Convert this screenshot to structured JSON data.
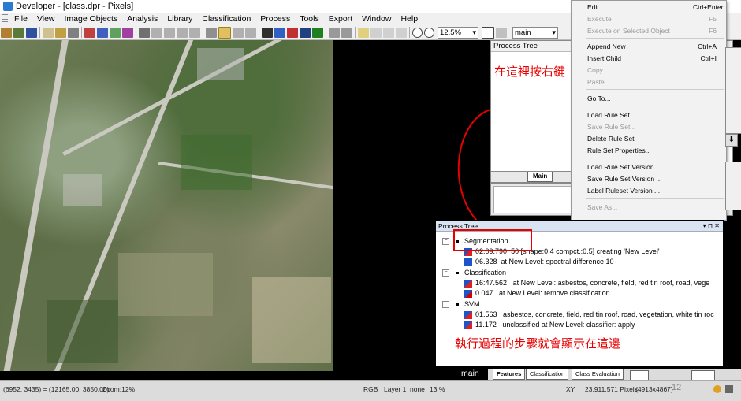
{
  "window": {
    "title": "Developer - [class.dpr - Pixels]"
  },
  "menu": [
    "File",
    "View",
    "Image Objects",
    "Analysis",
    "Library",
    "Classification",
    "Process",
    "Tools",
    "Export",
    "Window",
    "Help"
  ],
  "toolbar": {
    "zoom": "12.5%",
    "level": "main"
  },
  "process_tree_top": {
    "title": "Process Tree",
    "note": "在這裡按右鍵",
    "tab": "Main"
  },
  "context_menu": {
    "items": [
      {
        "label": "Edit...",
        "shortcut": "Ctrl+Enter",
        "enabled": true
      },
      {
        "label": "Execute",
        "shortcut": "F5",
        "enabled": false
      },
      {
        "label": "Execute on Selected Object",
        "shortcut": "F6",
        "enabled": false
      },
      {
        "label": "Append New",
        "shortcut": "Ctrl+A",
        "enabled": true
      },
      {
        "label": "Insert Child",
        "shortcut": "Ctrl+I",
        "enabled": true
      },
      {
        "label": "Copy",
        "shortcut": "",
        "enabled": false
      },
      {
        "label": "Paste",
        "shortcut": "",
        "enabled": false
      },
      {
        "label": "Go To...",
        "shortcut": "",
        "enabled": true
      },
      {
        "label": "Load Rule Set...",
        "shortcut": "",
        "enabled": true
      },
      {
        "label": "Save Rule Set...",
        "shortcut": "",
        "enabled": false
      },
      {
        "label": "Delete Rule Set",
        "shortcut": "",
        "enabled": true
      },
      {
        "label": "Rule Set Properties...",
        "shortcut": "",
        "enabled": true
      },
      {
        "label": "Load Rule Set Version ...",
        "shortcut": "",
        "enabled": true
      },
      {
        "label": "Save Rule Set Version ...",
        "shortcut": "",
        "enabled": true
      },
      {
        "label": "Label Ruleset Version ...",
        "shortcut": "",
        "enabled": true
      },
      {
        "label": "Save As...",
        "shortcut": "",
        "enabled": false
      }
    ]
  },
  "process_tree": {
    "title": "Process Tree",
    "groups": [
      {
        "name": "Segmentation",
        "rows": [
          {
            "time": "02:09.790",
            "text": "50 [shape:0.4 compct.:0.5] creating 'New Level'"
          },
          {
            "time": "06.328",
            "text": "at New Level: spectral difference 10"
          }
        ]
      },
      {
        "name": "Classification",
        "rows": [
          {
            "time": "16:47.562",
            "text": "at New Level: asbestos, concrete, field, red tin roof, road, vege"
          },
          {
            "time": "0.047",
            "text": "at New Level: remove classification"
          }
        ]
      },
      {
        "name": "SVM",
        "rows": [
          {
            "time": "01.563",
            "text": "asbestos, concrete, field, red tin roof, road, vegetation, white tin roc"
          },
          {
            "time": "11.172",
            "text": "unclassified at New Level: classifier: apply"
          }
        ]
      }
    ],
    "note": "執行過程的步驟就會顯示在這邊"
  },
  "bottom": {
    "main_label": "main",
    "tabs": [
      "Features",
      "Classification",
      "Class Evaluation"
    ],
    "page_number": "12"
  },
  "status": {
    "coords": "(6952, 3435) = (12165.00, 3850.00)",
    "zoom": "Zoom:12%",
    "mode": "RGB",
    "layer": "Layer 1",
    "none": "none",
    "percent": "13 %",
    "xy": "XY",
    "pixels": "23,911,571 Pixels",
    "size": "(4913x4867)"
  },
  "colors": {
    "annotation_red": "#e60000",
    "header_blue": "#d9e4f2"
  }
}
